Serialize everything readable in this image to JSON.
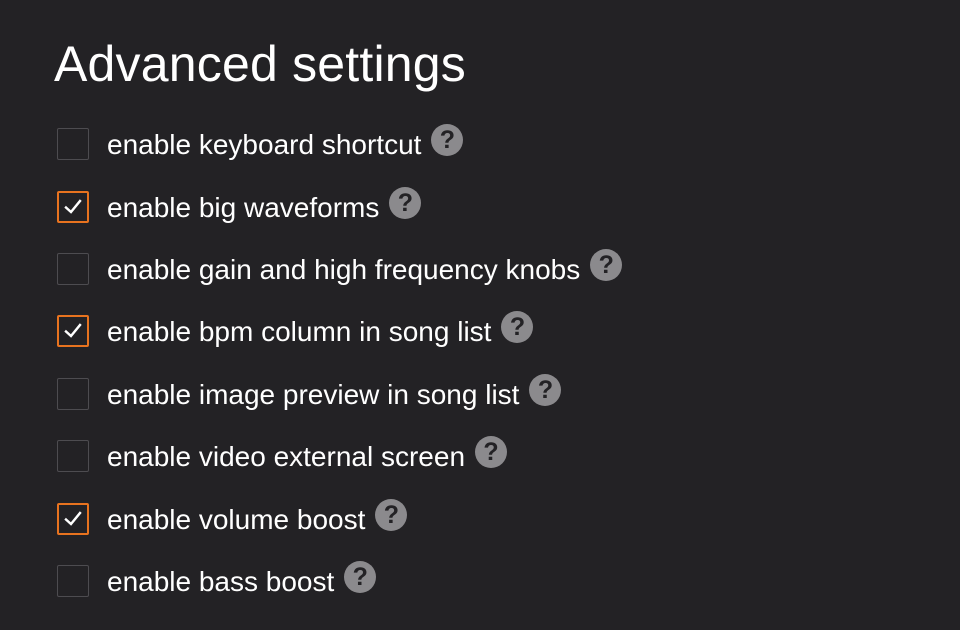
{
  "title": "Advanced settings",
  "accent_color": "#e8731f",
  "help_glyph": "?",
  "settings": [
    {
      "label": "enable keyboard shortcut",
      "checked": false,
      "help_icon": "question-circle-icon"
    },
    {
      "label": "enable big waveforms",
      "checked": true,
      "help_icon": "question-circle-icon"
    },
    {
      "label": "enable gain and high frequency knobs",
      "checked": false,
      "help_icon": "question-circle-icon"
    },
    {
      "label": "enable bpm column in song list",
      "checked": true,
      "help_icon": "question-circle-icon"
    },
    {
      "label": "enable image preview in song list",
      "checked": false,
      "help_icon": "question-circle-icon"
    },
    {
      "label": "enable video external screen",
      "checked": false,
      "help_icon": "question-circle-icon"
    },
    {
      "label": "enable volume boost",
      "checked": true,
      "help_icon": "question-circle-icon"
    },
    {
      "label": "enable bass boost",
      "checked": false,
      "help_icon": "question-circle-icon"
    }
  ]
}
